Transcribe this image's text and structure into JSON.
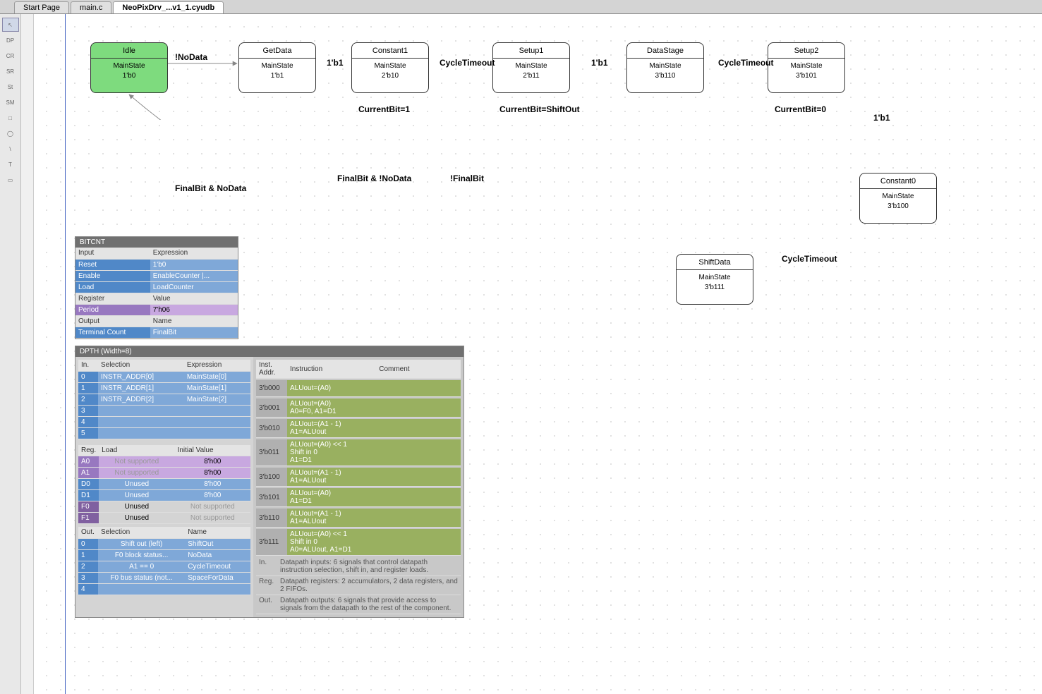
{
  "tabs": [
    {
      "label": "Start Page",
      "active": false
    },
    {
      "label": "main.c",
      "active": false
    },
    {
      "label": "NeoPixDrv_...v1_1.cyudb",
      "active": true
    }
  ],
  "tools": [
    "↖",
    "DP",
    "CR",
    "SR",
    "St",
    "SM",
    "□",
    "◯",
    "\\",
    "T",
    "▭"
  ],
  "states": {
    "idle": {
      "title": "Idle",
      "line1": "MainState",
      "line2": "1'b0"
    },
    "getdata": {
      "title": "GetData",
      "line1": "MainState",
      "line2": "1'b1"
    },
    "constant1": {
      "title": "Constant1",
      "line1": "MainState",
      "line2": "2'b10"
    },
    "setup1": {
      "title": "Setup1",
      "line1": "MainState",
      "line2": "2'b11"
    },
    "datastage": {
      "title": "DataStage",
      "line1": "MainState",
      "line2": "3'b110"
    },
    "setup2": {
      "title": "Setup2",
      "line1": "MainState",
      "line2": "3'b101"
    },
    "constant0": {
      "title": "Constant0",
      "line1": "MainState",
      "line2": "3'b100"
    },
    "shiftdata": {
      "title": "ShiftData",
      "line1": "MainState",
      "line2": "3'b111"
    }
  },
  "transitions": {
    "nodata": "!NoData",
    "b1_1": "1'b1",
    "cycletimeout1": "CycleTimeout",
    "b1_2": "1'b1",
    "cycletimeout2": "CycleTimeout",
    "b1_3": "1'b1",
    "cycletimeout3": "CycleTimeout",
    "currentbit1": "CurrentBit=1",
    "currentbitshift": "CurrentBit=ShiftOut",
    "currentbit0": "CurrentBit=0",
    "finalbit_nodata": "FinalBit & NoData",
    "finalbit_notnodata": "FinalBit & !NoData",
    "notfinalbit": "!FinalBit"
  },
  "bitcnt": {
    "title": "BITCNT",
    "headers1": {
      "c1": "Input",
      "c2": "Expression"
    },
    "rows1": [
      {
        "c1": "Reset",
        "c2": "1'b0"
      },
      {
        "c1": "Enable",
        "c2": "EnableCounter |..."
      },
      {
        "c1": "Load",
        "c2": "LoadCounter"
      }
    ],
    "headers2": {
      "c1": "Register",
      "c2": "Value"
    },
    "rows2": [
      {
        "c1": "Period",
        "c2": "7'h06"
      }
    ],
    "headers3": {
      "c1": "Output",
      "c2": "Name"
    },
    "rows3": [
      {
        "c1": "Terminal Count",
        "c2": "FinalBit"
      }
    ]
  },
  "dpth": {
    "title": "DPTH (Width=8)",
    "in_headers": {
      "c1": "In.",
      "c2": "Selection",
      "c3": "Expression"
    },
    "in_rows": [
      {
        "n": "0",
        "sel": "INSTR_ADDR[0]",
        "exp": "MainState[0]"
      },
      {
        "n": "1",
        "sel": "INSTR_ADDR[1]",
        "exp": "MainState[1]"
      },
      {
        "n": "2",
        "sel": "INSTR_ADDR[2]",
        "exp": "MainState[2]"
      },
      {
        "n": "3",
        "sel": "",
        "exp": ""
      },
      {
        "n": "4",
        "sel": "",
        "exp": ""
      },
      {
        "n": "5",
        "sel": "",
        "exp": ""
      }
    ],
    "reg_headers": {
      "c1": "Reg.",
      "c2": "Load",
      "c3": "Initial Value"
    },
    "reg_rows": [
      {
        "r": "A0",
        "load": "Not supported",
        "iv": "8'h00",
        "cls": "row-purple"
      },
      {
        "r": "A1",
        "load": "Not supported",
        "iv": "8'h00",
        "cls": "row-purple"
      },
      {
        "r": "D0",
        "load": "Unused",
        "iv": "8'h00",
        "cls": "row-blue"
      },
      {
        "r": "D1",
        "load": "Unused",
        "iv": "8'h00",
        "cls": "row-blue"
      },
      {
        "r": "F0",
        "load": "Unused",
        "iv": "Not supported",
        "cls": "row-purple2"
      },
      {
        "r": "F1",
        "load": "Unused",
        "iv": "Not supported",
        "cls": "row-purple2"
      }
    ],
    "out_headers": {
      "c1": "Out.",
      "c2": "Selection",
      "c3": "Name"
    },
    "out_rows": [
      {
        "n": "0",
        "sel": "Shift out (left)",
        "name": "ShiftOut"
      },
      {
        "n": "1",
        "sel": "F0 block status...",
        "name": "NoData"
      },
      {
        "n": "2",
        "sel": "A1 == 0",
        "name": "CycleTimeout"
      },
      {
        "n": "3",
        "sel": "F0 bus status (not...",
        "name": "SpaceForData"
      },
      {
        "n": "4",
        "sel": "",
        "name": ""
      }
    ],
    "inst_headers": {
      "c1": "Inst. Addr.",
      "c2": "Instruction",
      "c3": "Comment"
    },
    "inst_rows": [
      {
        "addr": "3'b000",
        "inst": "ALUout=(A0)"
      },
      {
        "addr": "3'b001",
        "inst": "ALUout=(A0)\nA0=F0, A1=D1"
      },
      {
        "addr": "3'b010",
        "inst": "ALUout=(A1 - 1)\nA1=ALUout"
      },
      {
        "addr": "3'b011",
        "inst": "ALUout=(A0) << 1\nShift in 0\nA1=D1"
      },
      {
        "addr": "3'b100",
        "inst": "ALUout=(A1 - 1)\nA1=ALUout"
      },
      {
        "addr": "3'b101",
        "inst": "ALUout=(A0)\nA1=D1"
      },
      {
        "addr": "3'b110",
        "inst": "ALUout=(A1 - 1)\nA1=ALUout"
      },
      {
        "addr": "3'b111",
        "inst": "ALUout=(A0) << 1\nShift in 0\nA0=ALUout, A1=D1"
      }
    ],
    "notes": [
      {
        "k": "In.",
        "t": "Datapath inputs: 6 signals that control datapath instruction selection, shift in, and register loads."
      },
      {
        "k": "Reg.",
        "t": "Datapath registers: 2 accumulators, 2 data registers, and 2 FIFOs."
      },
      {
        "k": "Out.",
        "t": "Datapath outputs: 6 signals that provide access to signals from the datapath to the rest of the component."
      }
    ]
  }
}
